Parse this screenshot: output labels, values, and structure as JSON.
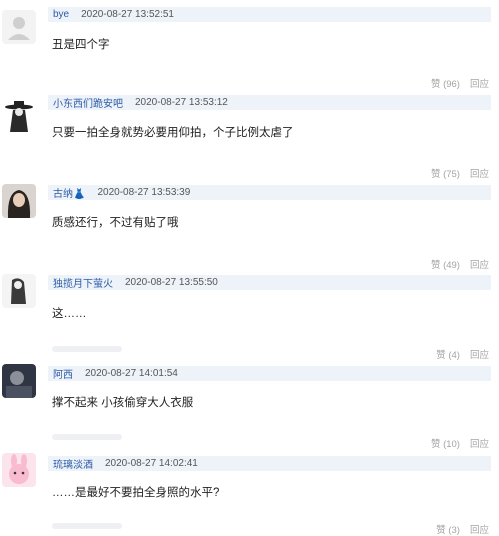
{
  "comments": [
    {
      "user": "bye",
      "time": "2020-08-27 13:52:51",
      "text": "丑是四个字",
      "likes": "赞 (96)",
      "reply": "回应",
      "avatar_icon": "default-avatar-icon"
    },
    {
      "user": "小东西们跪安吧",
      "time": "2020-08-27 13:53:12",
      "text": "只要一拍全身就势必要用仰拍，个子比例太虐了",
      "likes": "赞 (75)",
      "reply": "回应",
      "avatar_icon": "hat-figure-avatar-icon"
    },
    {
      "user": "古纳👗",
      "time": "2020-08-27 13:53:39",
      "text": "质感还行，不过有贴了哦",
      "likes": "赞 (49)",
      "reply": "回应",
      "avatar_icon": "girl-photo-avatar-icon"
    },
    {
      "user": "独揽月下萤火",
      "time": "2020-08-27 13:55:50",
      "text": "这……",
      "likes": "赞 (4)",
      "reply": "回应",
      "avatar_icon": "ink-figure-avatar-icon"
    },
    {
      "user": "阿西",
      "time": "2020-08-27 14:01:54",
      "text": "撑不起来 小孩偷穿大人衣服",
      "likes": "赞 (10)",
      "reply": "回应",
      "avatar_icon": "dark-photo-avatar-icon"
    },
    {
      "user": "琉璃淡酒",
      "time": "2020-08-27 14:02:41",
      "text": "……是最好不要拍全身照的水平?",
      "likes": "赞 (3)",
      "reply": "回应",
      "avatar_icon": "pink-bunny-avatar-icon"
    }
  ],
  "colors": {
    "meta_bar": "#eef3f9",
    "username": "#2b5aa6",
    "action": "#a4a4a4"
  }
}
